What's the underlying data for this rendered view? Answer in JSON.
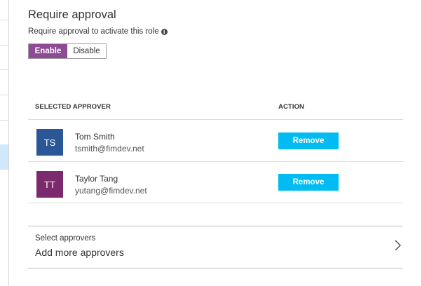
{
  "section": {
    "title": "Require approval",
    "subtitle": "Require approval to activate this role"
  },
  "toggle": {
    "enable_label": "Enable",
    "disable_label": "Disable",
    "selected": "Enable",
    "selected_color": "#8e4a94"
  },
  "table": {
    "headers": {
      "approver": "SELECTED APPROVER",
      "action": "ACTION"
    },
    "rows": [
      {
        "initials": "TS",
        "name": "Tom Smith",
        "email": "tsmith@fimdev.net",
        "avatar_color": "#2b5797",
        "action_label": "Remove"
      },
      {
        "initials": "TT",
        "name": "Taylor Tang",
        "email": "yutang@fimdev.net",
        "avatar_color": "#7b2a6e",
        "action_label": "Remove"
      }
    ],
    "button_color": "#00bcf2"
  },
  "select_approvers": {
    "label": "Select approvers",
    "value": "Add more approvers",
    "icon": "chevron-right-icon"
  }
}
